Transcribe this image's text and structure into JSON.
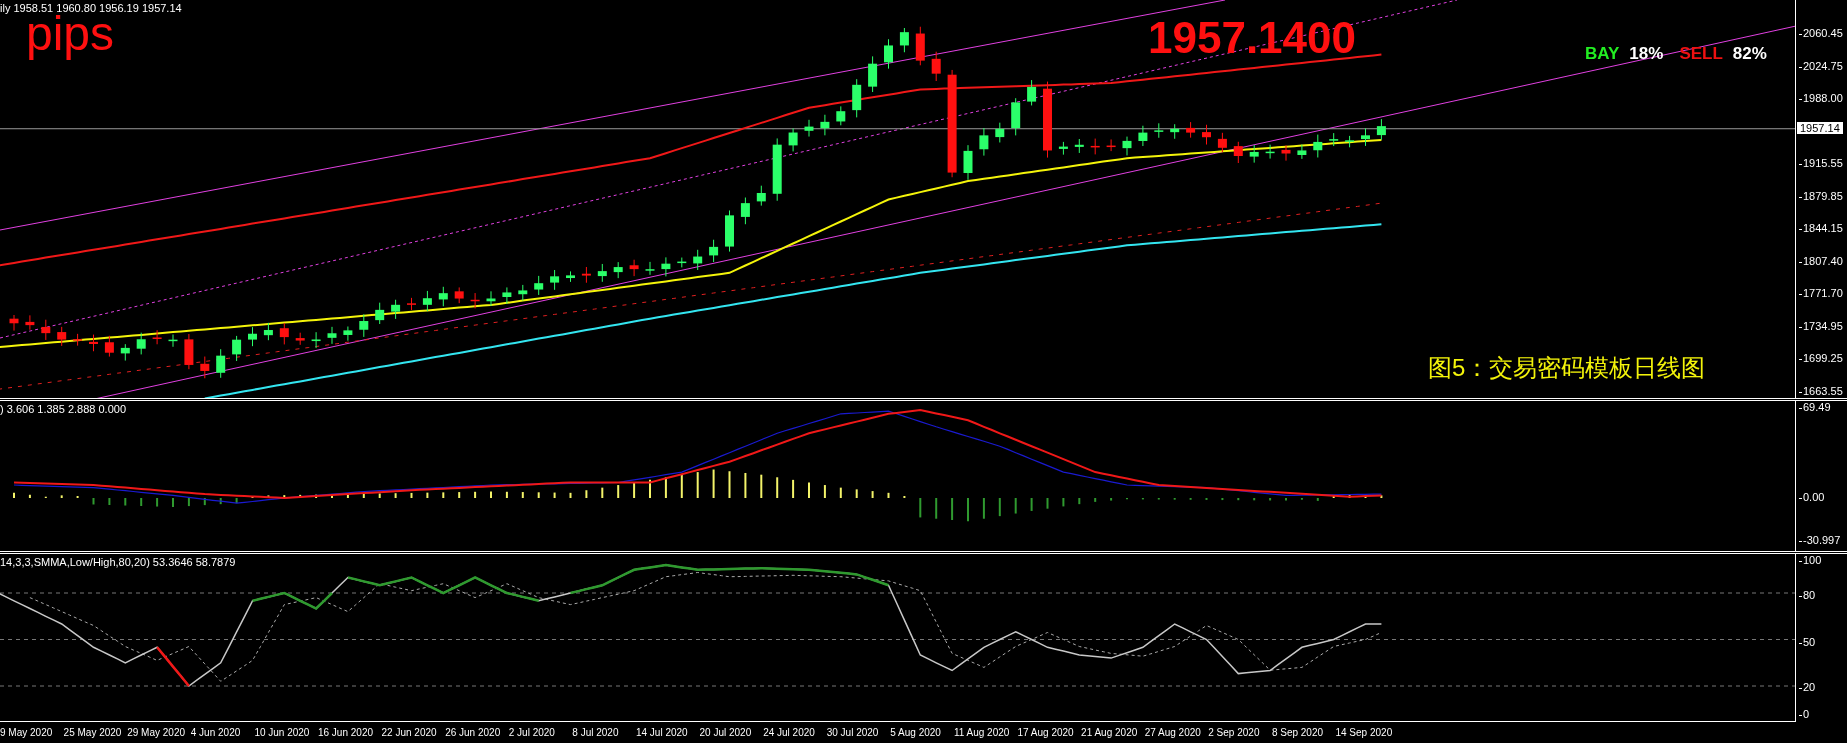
{
  "main_pane": {
    "header": "ily  1958.51 1960.80 1956.19 1957.14",
    "pips_label": "pips",
    "price_display": "1957.1400",
    "sentiment": [
      {
        "label": "BAY",
        "value": "18%",
        "color": "#22ee22"
      },
      {
        "label": "SELL",
        "value": "82%",
        "color": "#ee1111"
      }
    ],
    "caption": "图5：交易密码模板日线图",
    "axis_labels": [
      "2060.45",
      "2024.75",
      "1988.00",
      "1915.55",
      "1879.85",
      "1844.15",
      "1807.40",
      "1771.70",
      "1734.95",
      "1699.25",
      "1663.55"
    ],
    "current_price": "1957.14"
  },
  "macd_pane": {
    "header": ") 3.606 1.385 2.888 0.000",
    "axis_labels": [
      "69.49",
      "0.00",
      "-30.997"
    ]
  },
  "stochastic_pane": {
    "header": "14,3,3,SMMA,Low/High,80,20) 53.3646 58.7879",
    "axis_labels": [
      "100",
      "80",
      "50",
      "20",
      "0"
    ]
  },
  "time_axis": {
    "labels": [
      "9 May 2020",
      "25 May 2020",
      "29 May 2020",
      "4 Jun 2020",
      "10 Jun 2020",
      "16 Jun 2020",
      "22 Jun 2020",
      "26 Jun 2020",
      "2 Jul 2020",
      "8 Jul 2020",
      "14 Jul 2020",
      "20 Jul 2020",
      "24 Jul 2020",
      "30 Jul 2020",
      "5 Aug 2020",
      "11 Aug 2020",
      "17 Aug 2020",
      "21 Aug 2020",
      "27 Aug 2020",
      "2 Sep 2020",
      "8 Sep 2020",
      "14 Sep 2020"
    ]
  }
}
